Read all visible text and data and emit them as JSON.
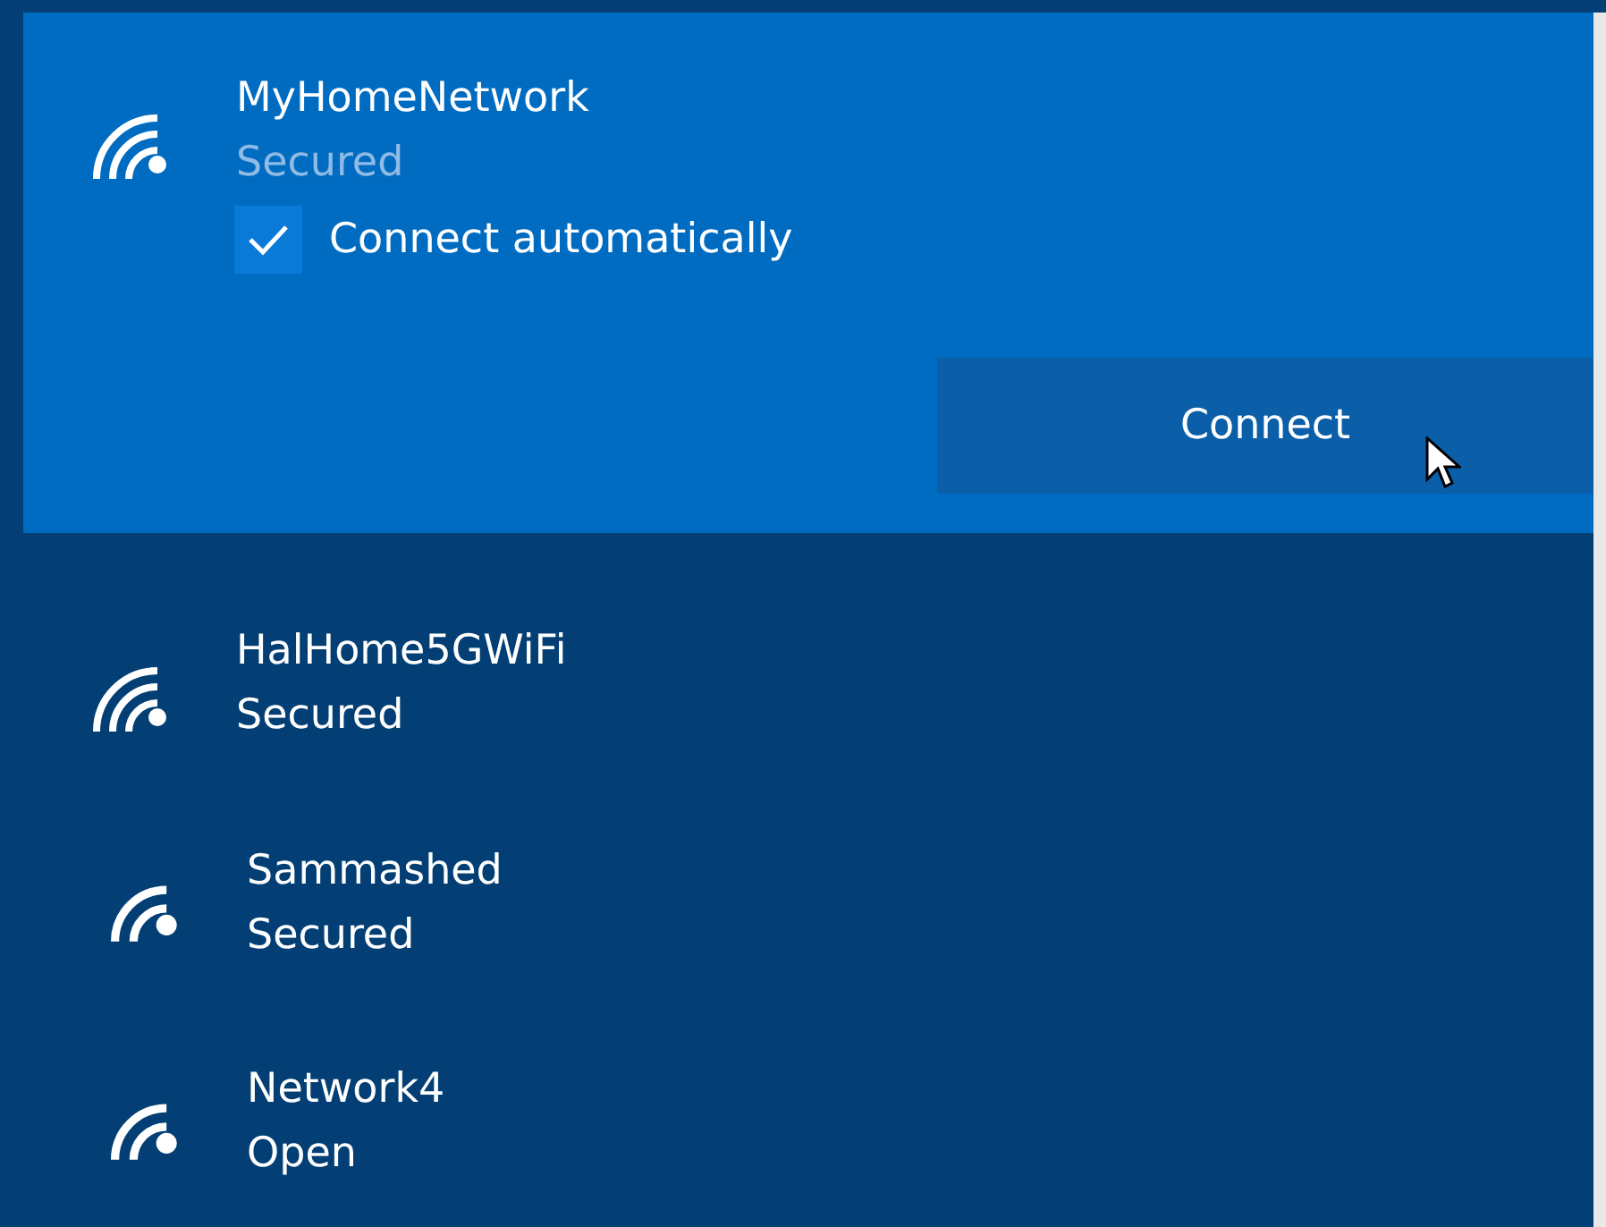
{
  "networks": [
    {
      "name": "MyHomeNetwork",
      "status": "Secured",
      "kind": "strong",
      "selected": true,
      "connect_automatically": {
        "label": "Connect automatically",
        "checked": true
      },
      "button": "Connect"
    },
    {
      "name": "HalHome5GWiFi",
      "status": "Secured",
      "kind": "strong",
      "selected": false
    },
    {
      "name": "Sammashed",
      "status": "Secured",
      "kind": "medium",
      "selected": false
    },
    {
      "name": "Network4",
      "status": "Open",
      "kind": "medium",
      "selected": false
    }
  ]
}
